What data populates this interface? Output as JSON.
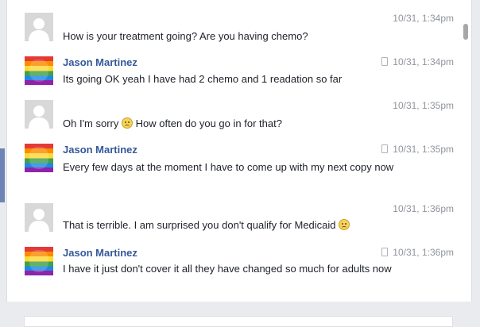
{
  "messages": [
    {
      "sender": "",
      "time": "10/31, 1:34pm",
      "text": "How is your treatment going? Are you having chemo?"
    },
    {
      "sender": "Jason Martinez",
      "time": "10/31, 1:34pm",
      "text": "Its going OK yeah I have had 2 chemo and 1 readation so far"
    },
    {
      "sender": "",
      "time": "10/31, 1:35pm",
      "text_before": "Oh I'm sorry",
      "text_after": "How often do you go in for that?"
    },
    {
      "sender": "Jason Martinez",
      "time": "10/31, 1:35pm",
      "text": "Every few days at the moment I have to come up with my next copy now"
    },
    {
      "sender": "",
      "time": "10/31, 1:36pm",
      "text": "That is terrible. I am surprised you don't qualify for Medicaid"
    },
    {
      "sender": "Jason Martinez",
      "time": "10/31, 1:36pm",
      "text": "I have it just don't cover it all they have changed so much for adults now"
    }
  ],
  "icons": {
    "mobile": "mobile-phone-icon",
    "sad_emoji": "frown-emoji-icon",
    "default_avatar": "default-avatar-icon"
  },
  "colors": {
    "sender_name": "#365899",
    "timestamp": "#90949c",
    "message_text": "#1d2129"
  }
}
